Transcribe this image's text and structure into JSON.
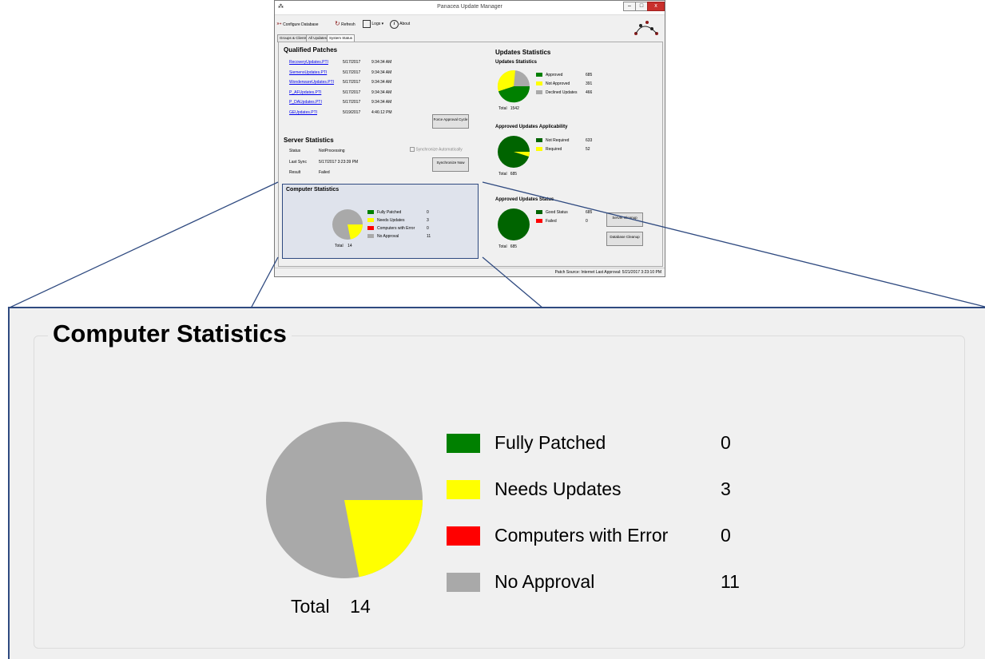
{
  "window": {
    "title": "Panacea Update Manager"
  },
  "toolbar": {
    "configure_database": "Configure Database",
    "refresh": "Refresh",
    "logs": "Logs",
    "about": "About"
  },
  "tabs": [
    "Groups & Clients",
    "All Updates",
    "System Status"
  ],
  "qualified_patches": {
    "title": "Qualified Patches",
    "rows": [
      {
        "name": "RecoveryUpdates.PTI",
        "date": "5/17/2017",
        "time": "9:34:34 AM"
      },
      {
        "name": "SiemensUpdates.PTI",
        "date": "5/17/2017",
        "time": "9:34:34 AM"
      },
      {
        "name": "WonderwareUpdates.PTI",
        "date": "5/17/2017",
        "time": "9:34:34 AM"
      },
      {
        "name": "P_AFUpdates.PTI",
        "date": "5/17/2017",
        "time": "9:34:34 AM"
      },
      {
        "name": "P_DAUpdates.PTI",
        "date": "5/17/2017",
        "time": "9:34:34 AM"
      },
      {
        "name": "GEUpdates.PTI",
        "date": "5/19/2017",
        "time": "4:46:12 PM"
      }
    ],
    "force_button": "Force Approval Cycle"
  },
  "server_statistics": {
    "title": "Server Statistics",
    "status_label": "Status",
    "status_value": "NotProcessing",
    "last_sync_label": "Last Sync",
    "last_sync_value": "5/17/2017 3:23:39 PM",
    "result_label": "Result",
    "result_value": "Failed",
    "sync_auto": "Synchronize Automatically",
    "sync_button": "Synchronize Now"
  },
  "computer_statistics": {
    "title": "Computer Statistics",
    "items": [
      {
        "label": "Fully Patched",
        "value": 0,
        "color": "#008000"
      },
      {
        "label": "Needs Updates",
        "value": 3,
        "color": "#ffff00"
      },
      {
        "label": "Computers with Error",
        "value": 0,
        "color": "#ff0000"
      },
      {
        "label": "No Approval",
        "value": 11,
        "color": "#a9a9a9"
      }
    ],
    "total_label": "Total",
    "total_value": "14"
  },
  "updates_statistics": {
    "title": "Updates Statistics",
    "sub": "Updates Statistics",
    "items": [
      {
        "label": "Approved",
        "value": 685,
        "color": "#008000"
      },
      {
        "label": "Not Approved",
        "value": 391,
        "color": "#ffff00"
      },
      {
        "label": "Declined Updates",
        "value": 466,
        "color": "#a9a9a9"
      }
    ],
    "total_label": "Total",
    "total_value": "1542"
  },
  "applicability": {
    "title": "Approved Updates Applicability",
    "items": [
      {
        "label": "Not Required",
        "value": 633,
        "color": "#006400"
      },
      {
        "label": "Required",
        "value": 52,
        "color": "#ffff00"
      }
    ],
    "total_label": "Total",
    "total_value": "685"
  },
  "approved_status": {
    "title": "Approved Updates Status",
    "items": [
      {
        "label": "Good Status",
        "value": 685,
        "color": "#006400"
      },
      {
        "label": "Failed",
        "value": 0,
        "color": "#ff0000"
      }
    ],
    "total_label": "Total",
    "total_value": "685",
    "server_cleanup": "Server Cleanup",
    "database_cleanup": "Database Cleanup"
  },
  "statusbar": {
    "text": "Patch Source: Internet  Last Approval: 5/21/2017 3:23:10 PM"
  }
}
